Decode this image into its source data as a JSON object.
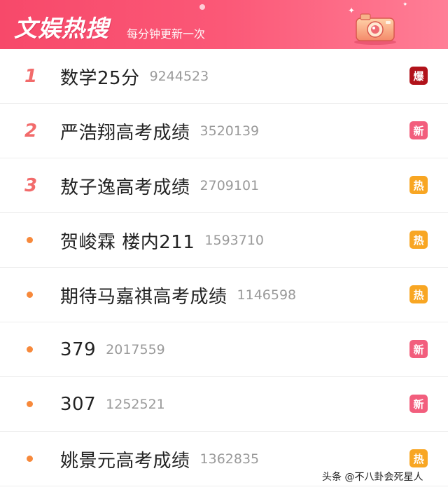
{
  "header": {
    "title": "文娱热搜",
    "subtitle": "每分钟更新一次"
  },
  "badge_colors": {
    "爆": "#b1121a",
    "新": "#f25e7d",
    "热": "#f8a623"
  },
  "items": [
    {
      "rank": "1",
      "title": "数学25分",
      "count": "9244523",
      "badge": "爆"
    },
    {
      "rank": "2",
      "title": "严浩翔高考成绩",
      "count": "3520139",
      "badge": "新"
    },
    {
      "rank": "3",
      "title": "敖子逸高考成绩",
      "count": "2709101",
      "badge": "热"
    },
    {
      "rank": "",
      "title": "贺峻霖 楼内211",
      "count": "1593710",
      "badge": "热"
    },
    {
      "rank": "",
      "title": "期待马嘉祺高考成绩",
      "count": "1146598",
      "badge": "热"
    },
    {
      "rank": "",
      "title": "379",
      "count": "2017559",
      "badge": "新"
    },
    {
      "rank": "",
      "title": "307",
      "count": "1252521",
      "badge": "新"
    },
    {
      "rank": "",
      "title": "姚景元高考成绩",
      "count": "1362835",
      "badge": "热"
    }
  ],
  "watermark": "头条 @不八卦会死星人"
}
